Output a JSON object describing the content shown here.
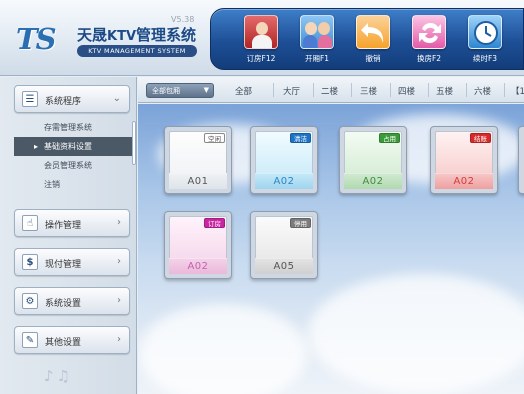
{
  "header": {
    "logo_mark": "TS",
    "version": "V5.38",
    "title_cn": "天晟",
    "title_ktv": "KTV",
    "title_suffix": "管理系统",
    "subtitle": "KTV MANAGEMENT SYSTEM"
  },
  "toolbar": [
    {
      "label": "订房F12",
      "icon": "order-room-icon"
    },
    {
      "label": "开厢F1",
      "icon": "open-room-icon"
    },
    {
      "label": "撤销",
      "icon": "undo-icon"
    },
    {
      "label": "换房F2",
      "icon": "change-room-icon"
    },
    {
      "label": "续时F3",
      "icon": "extend-time-icon"
    }
  ],
  "sidebar": {
    "program_label": "系统程序",
    "sub_items": [
      "存需管理系统",
      "基础资料设置",
      "会员管理系统",
      "注销"
    ],
    "active_sub_item": "基础资料设置",
    "menu": [
      {
        "label": "操作管理",
        "icon": "hand-icon"
      },
      {
        "label": "现付管理",
        "icon": "dollar-icon"
      },
      {
        "label": "系统设置",
        "icon": "gear-icon"
      },
      {
        "label": "其他设置",
        "icon": "wrench-icon"
      }
    ]
  },
  "tabs": {
    "filter_label": "全部包厢",
    "items": [
      "全部",
      "大厅",
      "二楼",
      "三楼",
      "四楼",
      "五楼",
      "六楼",
      "【1"
    ]
  },
  "rooms": [
    {
      "number": "A01",
      "status": "空闲",
      "state": "idle"
    },
    {
      "number": "A02",
      "status": "清洁",
      "state": "clean"
    },
    {
      "number": "A02",
      "status": "占用",
      "state": "occupied"
    },
    {
      "number": "A02",
      "status": "结账",
      "state": "checkout"
    },
    {
      "number": "A02",
      "status": "订房",
      "state": "reserved"
    },
    {
      "number": "A05",
      "status": "停用",
      "state": "disabled"
    }
  ],
  "colors": {
    "toolbar": "#1e4f96",
    "idle": "#ffffff",
    "clean": "#1d73c5",
    "occupied": "#3b9b3b",
    "checkout": "#d52b2b",
    "reserved": "#c727a0",
    "disabled": "#7c7c7c"
  }
}
